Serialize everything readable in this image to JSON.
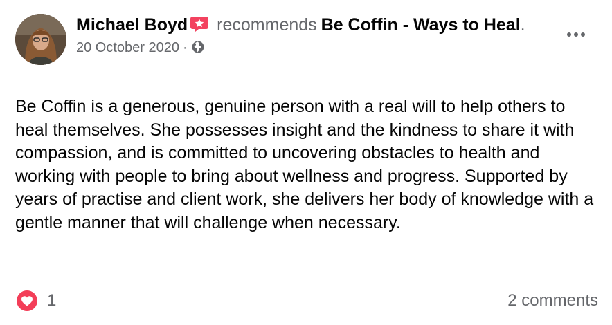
{
  "post": {
    "author": "Michael Boyd",
    "verb": "recommends",
    "page_name": "Be Coffin - Ways to Heal",
    "page_suffix": ".",
    "date": "20 October 2020",
    "separator": "·",
    "privacy_icon": "globe-icon",
    "recommendation_badge_icon": "star-badge-icon",
    "body": "Be Coffin is a generous, genuine person with a real will to help others to heal themselves. She possesses insight and the kindness to share it with compassion, and is committed to uncovering obstacles to health and working with people to bring about wellness and progress. Supported by years of practise and client work, she delivers her body of knowledge with a gentle manner that will challenge when necessary."
  },
  "footer": {
    "reaction_icon": "love-reaction-icon",
    "reaction_count": "1",
    "comments": "2 comments"
  },
  "colors": {
    "text": "#050505",
    "secondary_text": "#65676b",
    "badge": "#f3425f",
    "love": "#f33e58"
  }
}
